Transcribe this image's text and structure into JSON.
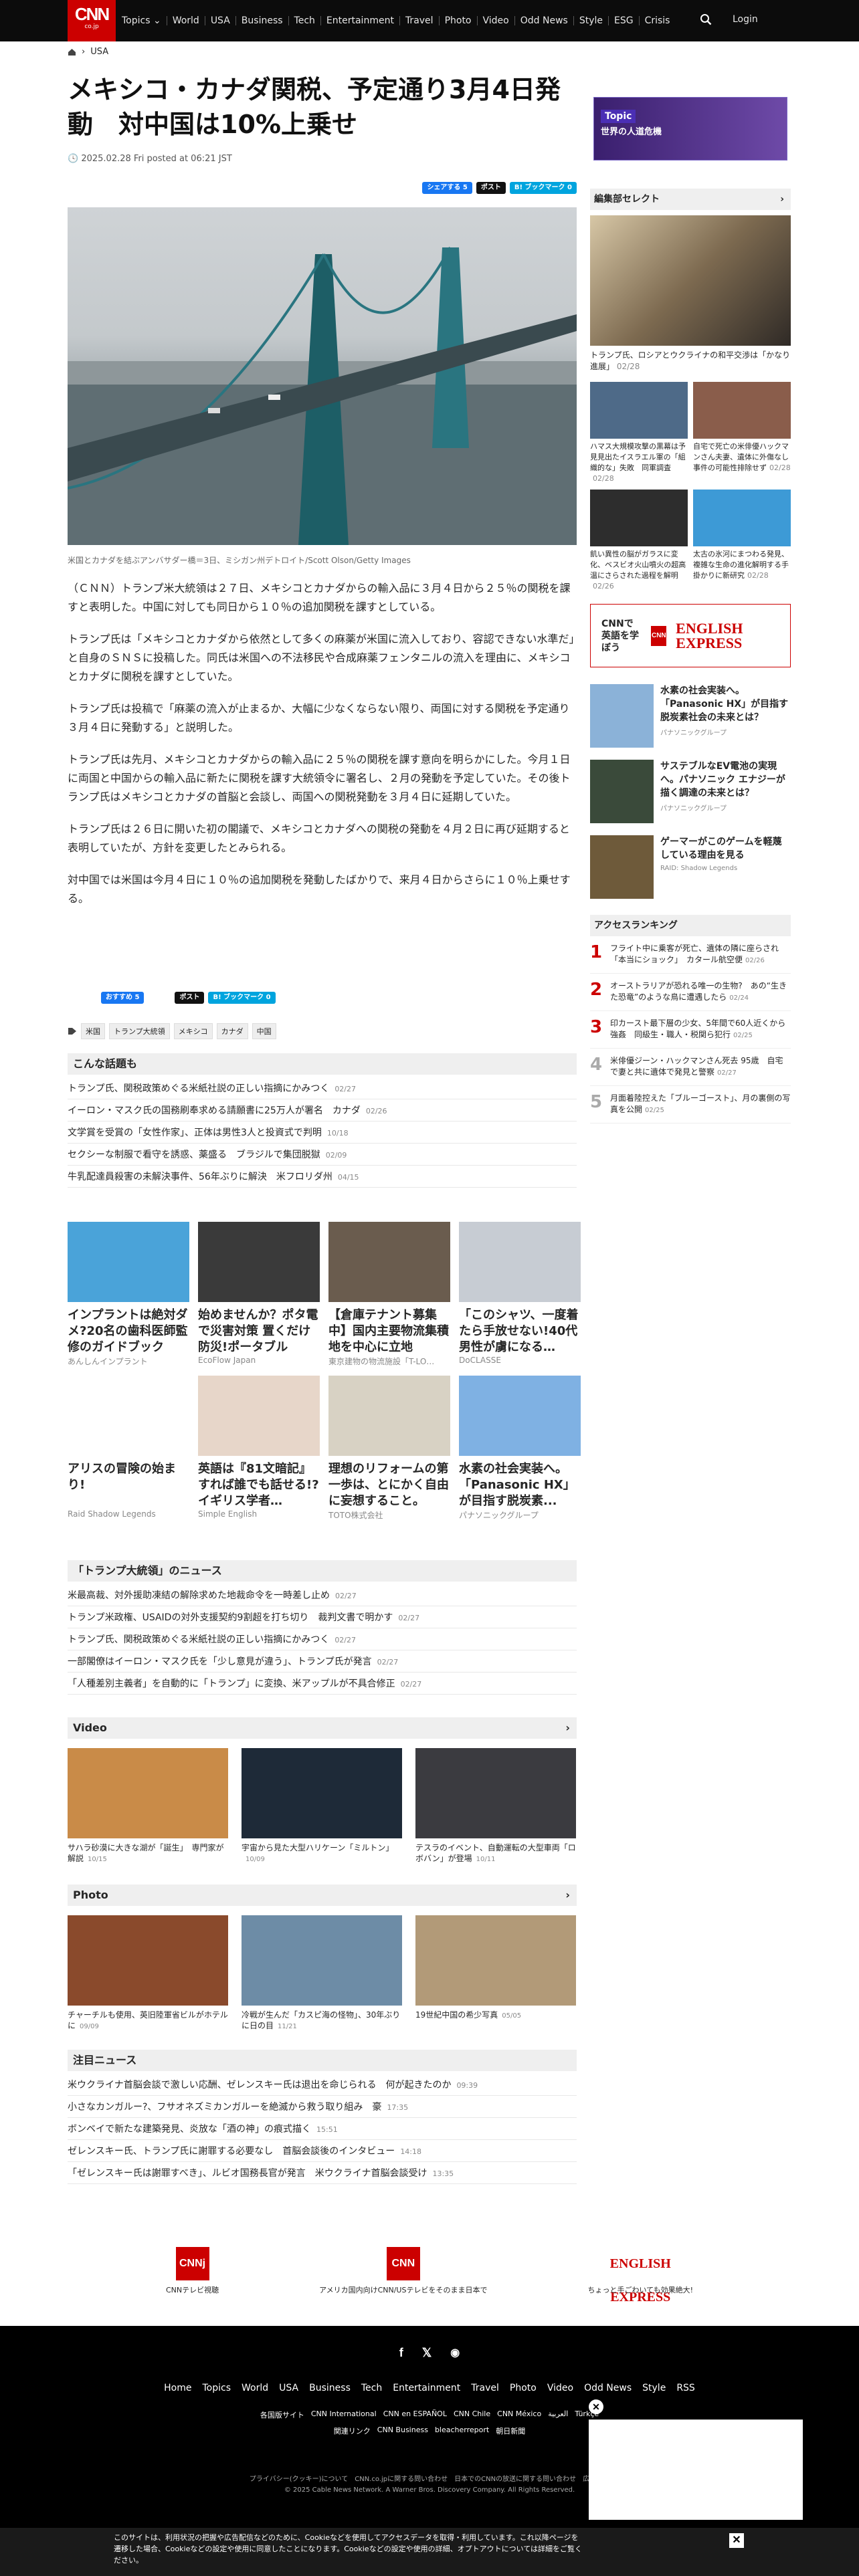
{
  "nav": {
    "logo": "CNN",
    "logo_sub": "co.jp",
    "topics": "Topics ⌄",
    "items": [
      "World",
      "USA",
      "Business",
      "Tech",
      "Entertainment",
      "Travel",
      "Photo",
      "Video",
      "Odd News",
      "Style",
      "ESG",
      "Crisis"
    ],
    "login": "Login"
  },
  "breadcrumb": {
    "section": "USA"
  },
  "article": {
    "title": "メキシコ・カナダ関税、予定通り3月4日発動　対中国は10%上乗せ",
    "date": "2025.02.28 Fri posted at 06:21 JST",
    "share": {
      "fb": "シェアする 5",
      "x": "ポスト",
      "hb": "B! ブックマーク 0"
    },
    "share2": {
      "fb": "おすすめ 5",
      "x": "ポスト",
      "hb": "B! ブックマーク 0"
    },
    "caption": "米国とカナダを結ぶアンバサダー橋＝3日、ミシガン州デトロイト/Scott Olson/Getty Images",
    "paragraphs": [
      "（ＣＮＮ）トランプ米大統領は２７日、メキシコとカナダからの輸入品に３月４日から２５％の関税を課すと表明した。中国に対しても同日から１０％の追加関税を課すとしている。",
      "トランプ氏は「メキシコとカナダから依然として多くの麻薬が米国に流入しており、容認できない水準だ」と自身のＳＮＳに投稿した。同氏は米国への不法移民や合成麻薬フェンタニルの流入を理由に、メキシコとカナダに関税を課すとしていた。",
      "トランプ氏は投稿で「麻薬の流入が止まるか、大幅に少なくならない限り、両国に対する関税を予定通り３月４日に発動する」と説明した。",
      "トランプ氏は先月、メキシコとカナダからの輸入品に２５％の関税を課す意向を明らかにした。今月１日に両国と中国からの輸入品に新たに関税を課す大統領令に署名し、２月の発動を予定していた。その後トランプ氏はメキシコとカナダの首脳と会談し、両国への関税発動を３月４日に延期していた。",
      "トランプ氏は２６日に開いた初の閣議で、メキシコとカナダへの関税の発動を４月２日に再び延期すると表明していたが、方針を変更したとみられる。",
      "対中国では米国は今月４日に１０％の追加関税を発動したばかりで、来月４日からさらに１０％上乗せする。"
    ],
    "tags": [
      "米国",
      "トランプ大統領",
      "メキシコ",
      "カナダ",
      "中国"
    ]
  },
  "related": {
    "title": "こんな話題も",
    "items": [
      {
        "t": "トランプ氏、関税政策めぐる米紙社説の正しい指摘にかみつく",
        "d": "02/27"
      },
      {
        "t": "イーロン・マスク氏の国務刷奉求める請願書に25万人が署名　カナダ",
        "d": "02/26"
      },
      {
        "t": "文学賞を受賞の「女性作家」、正体は男性3人と投資式で判明",
        "d": "10/18"
      },
      {
        "t": "セクシーな制服で看守を誘惑、薬盛る　ブラジルで集団脱獄",
        "d": "02/09"
      },
      {
        "t": "牛乳配達員殺害の未解決事件、56年ぶりに解決　米フロリダ州",
        "d": "04/15"
      }
    ]
  },
  "ads": [
    {
      "t": "インプラントは絶対ダメ?20名の歯科医師監修のガイドブック",
      "s": "あんしんインプラント",
      "c": "#4aa3d9"
    },
    {
      "t": "始めませんか？ポタ電で災害対策 置くだけ防災!ポータブル",
      "s": "EcoFlow Japan",
      "c": "#3a3a3a"
    },
    {
      "t": "【倉庫テナント募集中】国内主要物流集積地を中心に立地",
      "s": "東京建物の物流施設「T-LO…",
      "c": "#6a5c4e"
    },
    {
      "t": "「このシャツ、一度着たら手放せない!40代男性が虜になる…",
      "s": "DoCLASSE",
      "c": "#c7ccd3"
    },
    {
      "t": "アリスの冒険の始まり!",
      "s": "Raid Shadow Legends",
      "c": "#ffffff"
    },
    {
      "t": "英語は『81文暗記』すれば誰でも話せる!?イギリス学者…",
      "s": "Simple English",
      "c": "#e7d6c9"
    },
    {
      "t": "理想のリフォームの第一歩は、とにかく自由に妄想すること。",
      "s": "TOTO株式会社",
      "c": "#d8d2c4"
    },
    {
      "t": "水素の社会実装へ。「Panasonic HX」が目指す脱炭素...",
      "s": "パナソニックグループ",
      "c": "#7fb1e3"
    }
  ],
  "trump": {
    "title": "「トランプ大統領」のニュース",
    "items": [
      {
        "t": "米最高裁、対外援助凍結の解除求めた地裁命令を一時差し止め",
        "d": "02/27"
      },
      {
        "t": "トランプ米政権、USAIDの対外支援契約9割超を打ち切り　裁判文書で明かす",
        "d": "02/27"
      },
      {
        "t": "トランプ氏、関税政策めぐる米紙社説の正しい指摘にかみつく",
        "d": "02/27"
      },
      {
        "t": "一部閣僚はイーロン・マスク氏を「少し意見が違う」、トランプ氏が発言",
        "d": "02/27"
      },
      {
        "t": "「人種差別主義者」を自動的に「トランプ」に変換、米アップルが不具合修正",
        "d": "02/27"
      }
    ]
  },
  "video": {
    "title": "Video",
    "items": [
      {
        "t": "サハラ砂漠に大きな湖が「誕生」　専門家が解説",
        "d": "10/15",
        "c": "#c98b48"
      },
      {
        "t": "宇宙から見た大型ハリケーン「ミルトン」",
        "d": "10/09",
        "c": "#1e2a38"
      },
      {
        "t": "テスラのイベント、自動運転の大型車両「ロボバン」が登場",
        "d": "10/11",
        "c": "#3b3b40"
      }
    ]
  },
  "photo": {
    "title": "Photo",
    "items": [
      {
        "t": "チャーチルも使用、英旧陸軍省ビルがホテルに",
        "d": "09/09",
        "c": "#8a4a2c"
      },
      {
        "t": "冷戦が生んだ「カスピ海の怪物」、30年ぶりに日の目",
        "d": "11/21",
        "c": "#6d8ca6"
      },
      {
        "t": "19世紀中国の希少写真",
        "d": "05/05",
        "c": "#b29a78"
      }
    ]
  },
  "featured": {
    "title": "注目ニュース",
    "items": [
      {
        "t": "米ウクライナ首脳会談で激しい応酬、ゼレンスキー氏は退出を命じられる　何が起きたのか",
        "d": "09:39"
      },
      {
        "t": "小さなカンガルー?、フサオネズミカンガルーを絶滅から救う取り組み　豪",
        "d": "17:35"
      },
      {
        "t": "ボンベイで新たな建築発見、炎放な「酒の神」の痕式描く",
        "d": "15:51"
      },
      {
        "t": "ゼレンスキー氏、トランプ氏に謝罪する必要なし　首脳会談後のインタビュー",
        "d": "14:18"
      },
      {
        "t": "「ゼレンスキー氏は謝罪すべき」、ルビオ国務長官が発言　米ウクライナ首脳会談受け",
        "d": "13:35"
      }
    ]
  },
  "sidebar": {
    "topic_banner": {
      "label": "Topic",
      "text": "世界の人道危機"
    },
    "picks_title": "編集部セレクト",
    "top_pick": {
      "t": "トランプ氏、ロシアとウクライナの和平交渉は「かなり進展」",
      "d": "02/28"
    },
    "picks": [
      {
        "t": "ハマス大規模攻撃の黒幕は予見見出たイスラエル軍の「組織的な」失敗　同軍調査",
        "d": "02/28",
        "c": "#4e6a88"
      },
      {
        "t": "自宅で死亡の米俳優ハックマンさん夫妻、遺体に外傷なし　事件の可能性排除せず",
        "d": "02/28",
        "c": "#8a5d4b"
      },
      {
        "t": "飢い異性の脳がガラスに変化、ベスビオ火山噴火の超高温にさらされた過程を解明",
        "d": "02/26",
        "c": "#2d2d2d"
      },
      {
        "t": "太古の氷河にまつわる発見、複雑な生命の進化解明する手掛かりに新研究",
        "d": "02/28",
        "c": "#3d9ad6"
      }
    ],
    "english_ad": {
      "l": "CNNで英語を学ぼう",
      "r": "ENGLISH EXPRESS"
    },
    "sads": [
      {
        "t": "水素の社会実装へ。「Panasonic HX」が目指す脱炭素社会の未来とは？",
        "s": "パナソニックグループ",
        "c": "#8bb2d8"
      },
      {
        "t": "サステブルなEV電池の実現へ。パナソニック エナジーが描く調達の未来とは？",
        "s": "パナソニックグループ",
        "c": "#3a4a3a"
      },
      {
        "t": "ゲーマーがこのゲームを軽蔑している理由を見る",
        "s": "RAID: Shadow Legends",
        "c": "#6e5a3a"
      }
    ],
    "ranking_title": "アクセスランキング",
    "ranking": [
      {
        "n": "1",
        "t": "フライト中に乗客が死亡、遺体の隣に座らされ「本当にショック」　カタール航空便",
        "d": "02/26"
      },
      {
        "n": "2",
        "t": "オーストラリアが恐れる唯一の生物?　あの“生きた恐竜”のような鳥に遭遇したら",
        "d": "02/24"
      },
      {
        "n": "3",
        "t": "印カースト最下層の少女、5年間で60人近くから強姦　同級生・職人・税関ら犯行",
        "d": "02/25"
      },
      {
        "n": "4",
        "t": "米俳優ジーン・ハックマンさん死去 95歳　自宅で妻と共に遺体で発見と警察",
        "d": "02/27"
      },
      {
        "n": "5",
        "t": "月面着陸控えた「ブルーゴースト」、月の裏側の写真を公開",
        "d": "02/25"
      }
    ]
  },
  "footer": {
    "logos": [
      {
        "l": "CNNj",
        "s": "CNNテレビ視聴"
      },
      {
        "l": "CNN",
        "s": "アメリカ国内向けCNN/USテレビをそのまま日本で"
      },
      {
        "l": "ENGLISH EXPRESS",
        "s": "ちょっと手ごわいても効果絶大!"
      }
    ],
    "nav": [
      "Home",
      "Topics",
      "World",
      "USA",
      "Business",
      "Tech",
      "Entertainment",
      "Travel",
      "Photo",
      "Video",
      "Odd News",
      "Style",
      "RSS"
    ],
    "sites1": [
      "各国版サイト",
      "CNN International",
      "CNN en ESPAÑOL",
      "CNN Chile",
      "CNN México",
      "العربية",
      "Türkçe"
    ],
    "sites2": [
      "関連リンク",
      "CNN Business",
      "bleacherreport",
      "朝日新聞"
    ],
    "links": [
      "プライバシー(クッキー)について",
      "CNN.co.jpに関する問い合わせ",
      "日本でのCNNの放送に関する問い合わせ",
      "広告掲載"
    ],
    "copy": "© 2025 Cable News Network. A Warner Bros. Discovery Company. All Rights Reserved."
  },
  "cookie": {
    "text": "このサイトは、利用状況の把握や広告配信などのために、Cookieなどを使用してアクセスデータを取得・利用しています。これ以降ページを遷移した場合、Cookieなどの設定や使用に同意したことになります。Cookieなどの設定や使用の詳細、オプトアウトについては詳細をご覧ください。"
  }
}
